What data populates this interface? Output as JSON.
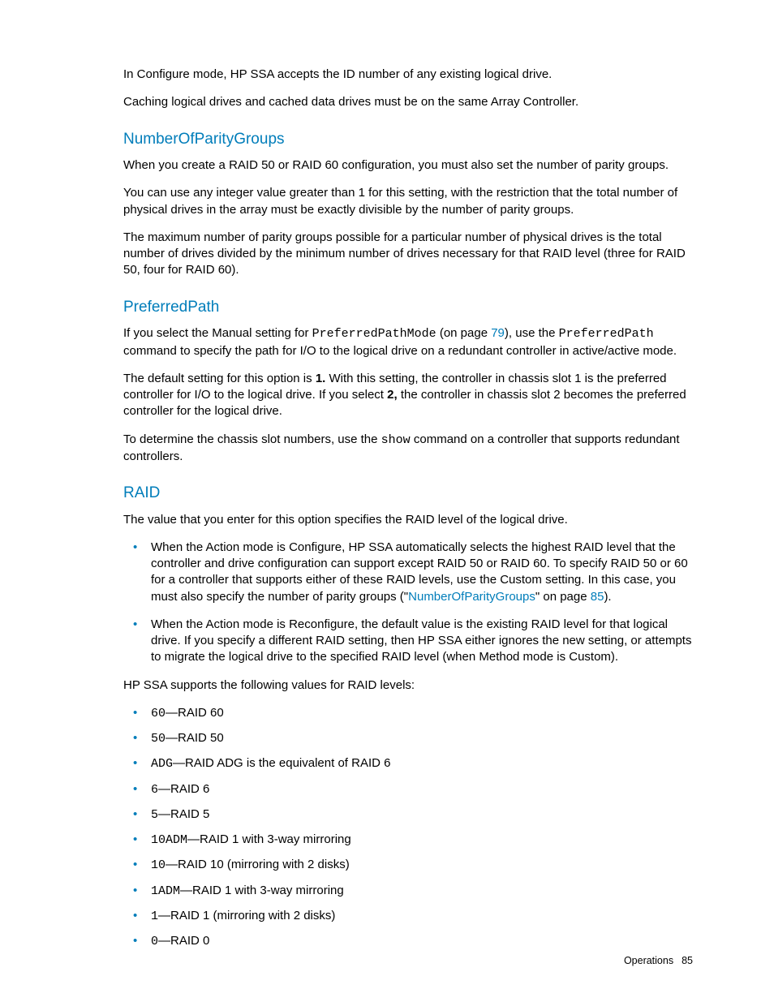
{
  "intro": {
    "p1": "In Configure mode, HP SSA accepts the ID number of any existing logical drive.",
    "p2": "Caching logical drives and cached data drives must be on the same Array Controller."
  },
  "sec1": {
    "heading": "NumberOfParityGroups",
    "p1": "When you create a RAID 50 or RAID 60 configuration, you must also set the number of parity groups.",
    "p2": "You can use any integer value greater than 1 for this setting, with the restriction that the total number of physical drives in the array must be exactly divisible by the number of parity groups.",
    "p3": "The maximum number of parity groups possible for a particular number of physical drives is the total number of drives divided by the minimum number of drives necessary for that RAID level (three for RAID 50, four for RAID 60)."
  },
  "sec2": {
    "heading": "PreferredPath",
    "p1a": "If you select the Manual setting for ",
    "p1_code": "PreferredPathMode",
    "p1b": " (on page ",
    "p1_page": "79",
    "p1c": "), use the ",
    "p1_code2": "PreferredPath",
    "p1d": " command to specify the path for I/O to the logical drive on a redundant controller in active/active mode.",
    "p2a": "The default setting for this option is ",
    "p2b1": "1.",
    "p2c": " With this setting, the controller in chassis slot 1 is the preferred controller for I/O to the logical drive. If you select ",
    "p2b2": "2,",
    "p2d": " the controller in chassis slot 2 becomes the preferred controller for the logical drive.",
    "p3a": "To determine the chassis slot numbers, use the ",
    "p3_code": "show",
    "p3b": " command on a controller that supports redundant controllers."
  },
  "sec3": {
    "heading": "RAID",
    "p1": "The value that you enter for this option specifies the RAID level of the logical drive.",
    "bullet1a": "When the Action mode is Configure, HP SSA automatically selects the highest RAID level that the controller and drive configuration can support except RAID 50 or RAID 60. To specify RAID 50 or 60 for a controller that supports either of these RAID levels, use the Custom setting. In this case, you must also specify the number of parity groups (\"",
    "bullet1_link": "NumberOfParityGroups",
    "bullet1b": "\" on page ",
    "bullet1_page": "85",
    "bullet1c": ").",
    "bullet2": "When the Action mode is Reconfigure, the default value is the existing RAID level for that logical drive. If you specify a different RAID setting, then HP SSA either ignores the new setting, or attempts to migrate the logical drive to the specified RAID level (when Method mode is Custom).",
    "p2": "HP SSA supports the following values for RAID levels:",
    "levels": [
      {
        "code": "60",
        "desc": "—RAID 60"
      },
      {
        "code": "50",
        "desc": "—RAID 50"
      },
      {
        "code": "ADG",
        "desc": "—RAID ADG is the equivalent of RAID 6"
      },
      {
        "code": "6",
        "desc": "—RAID 6"
      },
      {
        "code": "5",
        "desc": "—RAID 5"
      },
      {
        "code": "10ADM",
        "desc": "—RAID 1 with 3-way mirroring"
      },
      {
        "code": "10",
        "desc": "—RAID 10 (mirroring with 2 disks)"
      },
      {
        "code": "1ADM",
        "desc": "—RAID 1 with 3-way mirroring"
      },
      {
        "code": "1",
        "desc": "—RAID 1 (mirroring with 2 disks)"
      },
      {
        "code": "0",
        "desc": "—RAID 0"
      }
    ]
  },
  "footer": {
    "section": "Operations",
    "page": "85"
  }
}
